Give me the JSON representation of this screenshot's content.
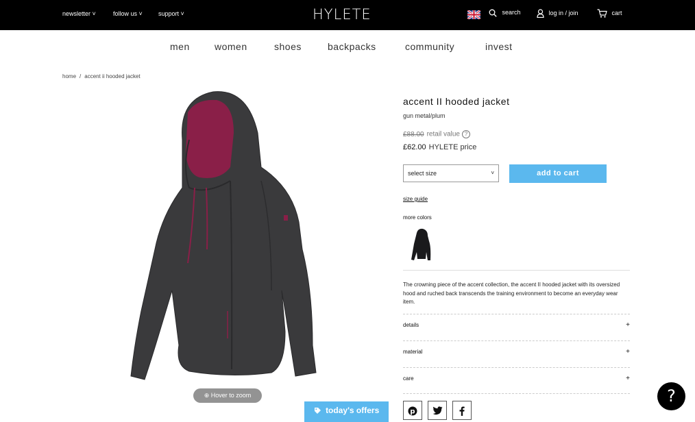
{
  "topbar": {
    "newsletter": "newsletter",
    "follow_us": "follow us",
    "support": "support",
    "logo": "HYLETE",
    "search": "search",
    "login": "log in / join",
    "cart": "cart"
  },
  "nav": [
    "men",
    "women",
    "shoes",
    "backpacks",
    "community",
    "invest"
  ],
  "breadcrumb": {
    "home": "home",
    "sep": "/",
    "current": "accent ii hooded jacket"
  },
  "gallery": {
    "zoom_label": "Hover to zoom"
  },
  "offers_label": "today's offers",
  "product": {
    "title": "accent II hooded jacket",
    "color": "gun metal/plum",
    "retail_price": "£88.00",
    "retail_label": "retail value",
    "hylete_price": "£62.00",
    "hylete_label": "HYLETE price",
    "size_placeholder": "select size",
    "add_to_cart": "add to cart",
    "size_guide": "size guide",
    "more_colors": "more colors",
    "description": "The crowning piece of the accent collection, the accent II hooded jacket with its oversized hood and ruched back transcends the training environment to become an everyday wear item.",
    "accordions": [
      "details",
      "material",
      "care"
    ]
  },
  "help_label": "?",
  "colors": {
    "accent_blue": "#5bb8ee",
    "jacket": "#3a3a3c",
    "lining": "#8a1f48"
  }
}
